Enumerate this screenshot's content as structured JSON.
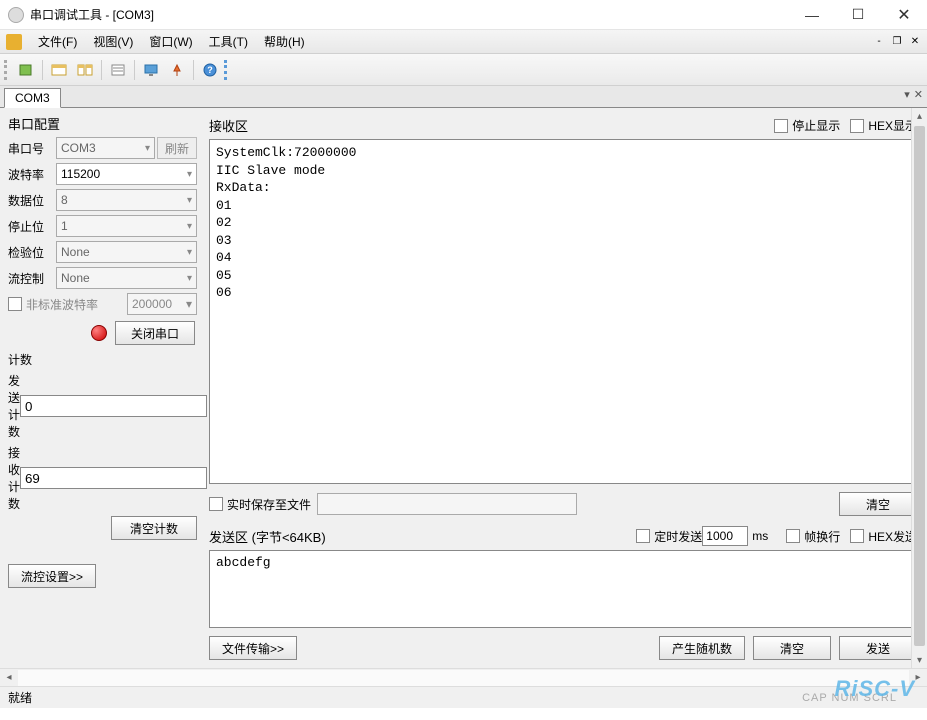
{
  "title": "串口调试工具 - [COM3]",
  "menus": {
    "file": "文件(F)",
    "view": "视图(V)",
    "window": "窗口(W)",
    "tools": "工具(T)",
    "help": "帮助(H)"
  },
  "tab": {
    "com3": "COM3"
  },
  "config": {
    "group": "串口配置",
    "port_label": "串口号",
    "port_value": "COM3",
    "refresh": "刷新",
    "baud_label": "波特率",
    "baud_value": "115200",
    "databits_label": "数据位",
    "databits_value": "8",
    "stopbits_label": "停止位",
    "stopbits_value": "1",
    "parity_label": "检验位",
    "parity_value": "None",
    "flow_label": "流控制",
    "flow_value": "None",
    "nonstd_label": "非标准波特率",
    "nonstd_value": "200000",
    "close_port": "关闭串口"
  },
  "counts": {
    "group": "计数",
    "send_label": "发送计数",
    "send_value": "0",
    "recv_label": "接收计数",
    "recv_value": "69",
    "clear": "清空计数"
  },
  "flow_btn": "流控设置>>",
  "recv": {
    "title": "接收区",
    "stop_display": "停止显示",
    "hex_display": "HEX显示",
    "text": "SystemClk:72000000\nIIC Slave mode\nRxData:\n01\n02\n03\n04\n05\n06",
    "save_to_file": "实时保存至文件",
    "clear": "清空"
  },
  "send": {
    "title": "发送区 (字节<64KB)",
    "timed": "定时发送",
    "interval": "1000",
    "ms": "ms",
    "wrap": "帧换行",
    "hex": "HEX发送",
    "text": "abcdefg",
    "file_btn": "文件传输>>",
    "random": "产生随机数",
    "clear": "清空",
    "send_btn": "发送"
  },
  "statusbar": {
    "ready": "就绪",
    "indicators": "CAP  NUM  SCRL"
  },
  "watermark": "RiSC-V"
}
